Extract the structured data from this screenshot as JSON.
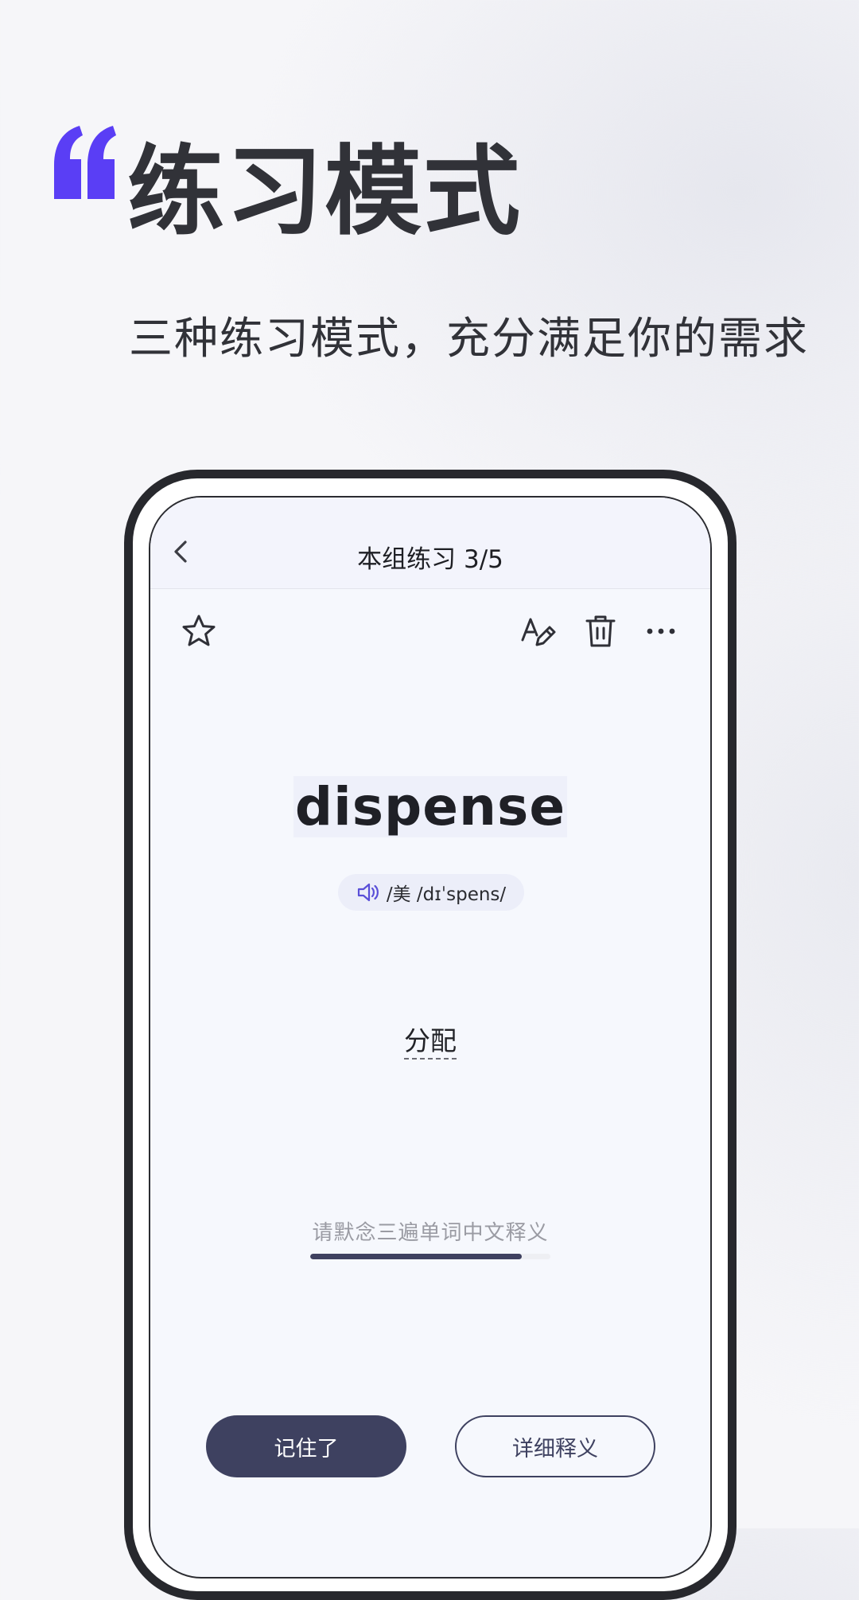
{
  "colors": {
    "accent": "#5a3ef5",
    "primary_dark": "#3e4160",
    "text_dark": "#313238"
  },
  "header": {
    "title": "练习模式",
    "subtitle": "三种练习模式，充分满足你的需求"
  },
  "phone": {
    "nav": {
      "title": "本组练习  3/5",
      "back_icon": "chevron-left-icon"
    },
    "toolbar": {
      "icons": [
        "star-icon",
        "edit-text-icon",
        "trash-icon",
        "more-icon"
      ]
    },
    "card": {
      "word": "dispense",
      "phonetic": "/美  /dɪˈspens/",
      "speaker_icon": "speaker-icon",
      "meaning": "分配",
      "hint": "请默念三遍单词中文释义",
      "progress": 0.88
    },
    "buttons": {
      "remember": "记住了",
      "details": "详细释义"
    }
  }
}
